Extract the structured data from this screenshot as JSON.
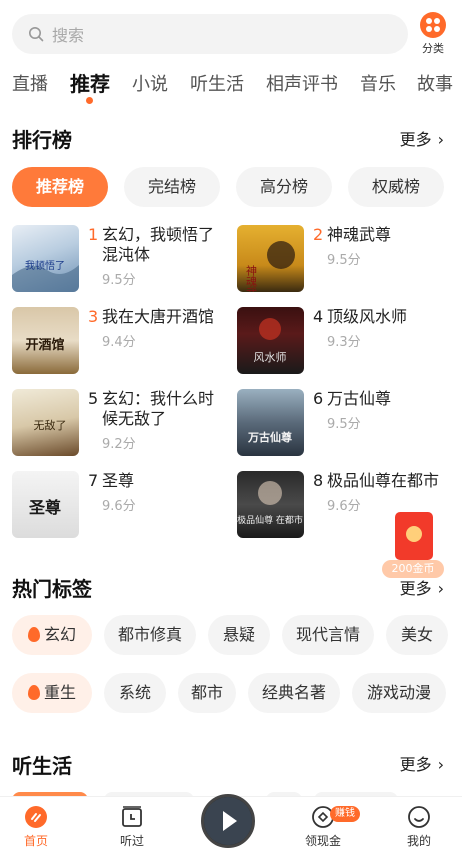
{
  "search": {
    "placeholder": "搜索"
  },
  "category": {
    "label": "分类"
  },
  "tabs": [
    "直播",
    "推荐",
    "小说",
    "听生活",
    "相声评书",
    "音乐",
    "故事"
  ],
  "ranking": {
    "title": "排行榜",
    "more": "更多",
    "tabs": [
      "推荐榜",
      "完结榜",
      "高分榜",
      "权威榜"
    ],
    "books": [
      {
        "rank": "1",
        "title": "玄幻，我顿悟了混沌体",
        "score": "9.5分",
        "cover_text": "我顿悟了"
      },
      {
        "rank": "2",
        "title": "神魂武尊",
        "score": "9.5分",
        "cover_text": "神魂武尊"
      },
      {
        "rank": "3",
        "title": "我在大唐开酒馆",
        "score": "9.4分",
        "cover_text": "开酒馆"
      },
      {
        "rank": "4",
        "title": "顶级风水师",
        "score": "9.3分",
        "cover_text": "风水师"
      },
      {
        "rank": "5",
        "title": "玄幻：我什么时候无敌了",
        "score": "9.2分",
        "cover_text": "无敌了"
      },
      {
        "rank": "6",
        "title": "万古仙尊",
        "score": "9.5分",
        "cover_text": "万古仙尊"
      },
      {
        "rank": "7",
        "title": "圣尊",
        "score": "9.6分",
        "cover_text": "圣尊"
      },
      {
        "rank": "8",
        "title": "极品仙尊在都市",
        "score": "9.6分",
        "cover_text": "极品仙尊 在都市"
      }
    ]
  },
  "tags": {
    "title": "热门标签",
    "more": "更多",
    "row1": [
      "玄幻",
      "都市修真",
      "悬疑",
      "现代言情",
      "美女"
    ],
    "row2": [
      "重生",
      "系统",
      "都市",
      "经典名著",
      "游戏动漫"
    ]
  },
  "listen": {
    "title": "听生活",
    "more": "更多"
  },
  "redpacket": {
    "label": "200金币"
  },
  "nav": {
    "home": "首页",
    "history": "听过",
    "cash": "领现金",
    "cash_badge": "赚钱",
    "me": "我的"
  },
  "colors": {
    "accent": "#ff6a2a"
  }
}
